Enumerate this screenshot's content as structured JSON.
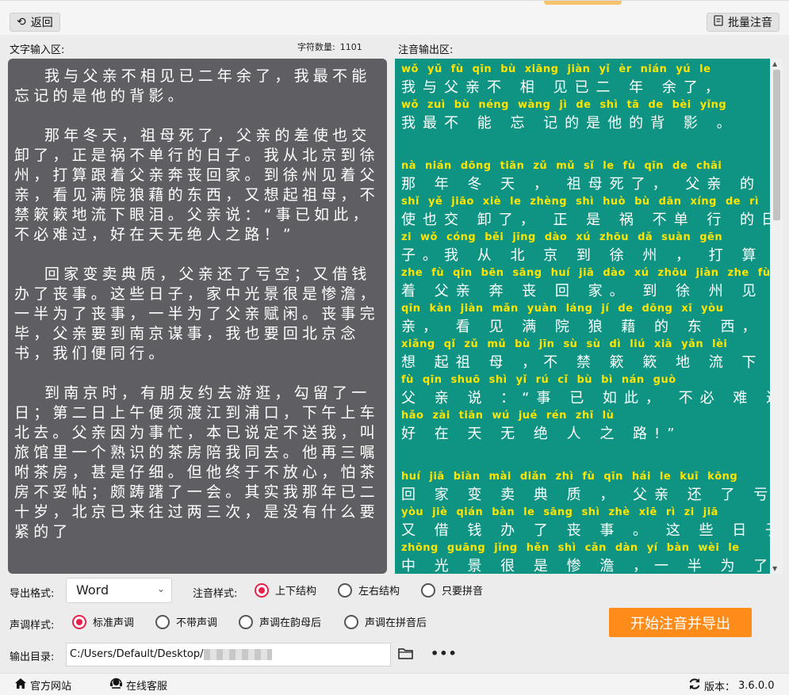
{
  "toolbar": {
    "back_label": "返回",
    "batch_label": "批量注音"
  },
  "input": {
    "label": "文字输入区:",
    "count_label": "字符数量:",
    "count_value": "1101",
    "paragraphs": [
      "我与父亲不相见已二年余了，我最不能忘记的是他的背影。",
      "那年冬天，祖母死了，父亲的差使也交卸了，正是祸不单行的日子。我从北京到徐州，打算跟着父亲奔丧回家。到徐州见着父亲，看见满院狼藉的东西，又想起祖母，不禁簌簌地流下眼泪。父亲说：“事已如此，不必难过，好在天无绝人之路！”",
      "回家变卖典质，父亲还了亏空；又借钱办了丧事。这些日子，家中光景很是惨澹，一半为了丧事，一半为了父亲赋闲。丧事完毕，父亲要到南京谋事，我也要回北京念书，我们便同行。",
      "到南京时，有朋友约去游逛，勾留了一日；第二日上午便须渡江到浦口，下午上车北去。父亲因为事忙，本已说定不送我，叫旅馆里一个熟识的茶房陪我同去。他再三嘱咐茶房，甚是仔细。但他终于不放心，怕茶房不妥帖；颇踌躇了一会。其实我那年已二十岁，北京已来往过两三次，是没有什么要紧的了"
    ]
  },
  "output": {
    "label": "注音输出区:",
    "paragraphs": [
      [
        {
          "py": "wǒ yǔ fù qīn bù xiāng jiàn yǐ èr nián yú le",
          "hz": "  我与父亲不 相 见已二 年 余了，"
        },
        {
          "py": "wǒ zuì bù néng wàng jì de shì tā de bèi yǐng",
          "hz": "我最不 能  忘 记的是他的背 影 。"
        }
      ],
      [
        {
          "py": "nà nián dōng tiān     zǔ mǔ sǐ le      fù qīn de chāi",
          "hz": "那 年  冬  天 ， 祖母死了， 父亲 的 差"
        },
        {
          "py": "shǐ yě jiāo xiè le      zhèng shì huò bù dān xíng de rì",
          "hz": "使也交 卸了，  正  是 祸 不单 行 的日"
        },
        {
          "py": "zi     wǒ cóng běi jīng dào xú zhōu     dǎ suàn gēn",
          "hz": "子。我 从 北 京 到 徐 州 ， 打 算  跟"
        },
        {
          "py": "zhe fù qīn bēn sāng huí jiā     dào xú zhōu jiàn zhe fù",
          "hz": "着 父亲 奔  丧  回 家。 到 徐 州  见 着 父"
        },
        {
          "py": "qīn     kàn jiàn mǎn yuàn láng jí de dōng xī     yòu",
          "hz": "亲， 看 见  满  院  狼 藉 的 东  西， 又"
        },
        {
          "py": "xiǎng qǐ zǔ mǔ     bù jīn sù sù dì liú xià yǎn lèi",
          "hz": " 想  起祖 母 ，不 禁 簌 簌 地 流 下 眼 泪 。"
        },
        {
          "py": "fù qīn shuō       shì yǐ rú cǐ      bù bì nán guò",
          "hz": "父 亲  说  ：“事 已 如此， 不必 难  过 ，"
        },
        {
          "py": "hǎo zài tiān wú jué rén zhī lù",
          "hz": "好 在  天 无 绝  人 之 路!”"
        }
      ],
      [
        {
          "py": "huí jiā biàn mài diǎn zhì     fù qīn hái le kuī kōng",
          "hz": "回 家  变  卖  典  质 ， 父亲 还 了 亏 空  ；"
        },
        {
          "py": "yòu jiè qián bàn le sāng shì     zhè xiē rì zi     jiā",
          "hz": "又 借 钱  办 了  丧  事 。 这  些 日 子，  家"
        },
        {
          "py": "zhōng guāng jǐng hěn shì cǎn dàn     yí bàn wèi le",
          "hz": " 中  光   景  很 是 惨  澹 ，一 半  为 了"
        }
      ]
    ]
  },
  "options": {
    "format_label": "导出格式:",
    "format_value": "Word",
    "style_label": "注音样式:",
    "style_options": [
      "上下结构",
      "左右结构",
      "只要拼音"
    ],
    "tone_label": "声调样式:",
    "tone_options": [
      "标准声调",
      "不带声调",
      "声调在韵母后",
      "声调在拼音后"
    ],
    "start_label": "开始注音并导出",
    "dir_label": "输出目录:",
    "dir_value": "C:/Users/Default/Desktop/",
    "more_label": "•••"
  },
  "footer": {
    "website": "官方网站",
    "service": "在线客服",
    "version_label": "版本：",
    "version_value": "3.6.0.0"
  },
  "colors": {
    "accent": "#ff8c1a",
    "output_bg": "#0f9483",
    "pinyin": "#ffe400",
    "input_bg": "#5f5f63",
    "radio_selected": "#e8204a"
  }
}
